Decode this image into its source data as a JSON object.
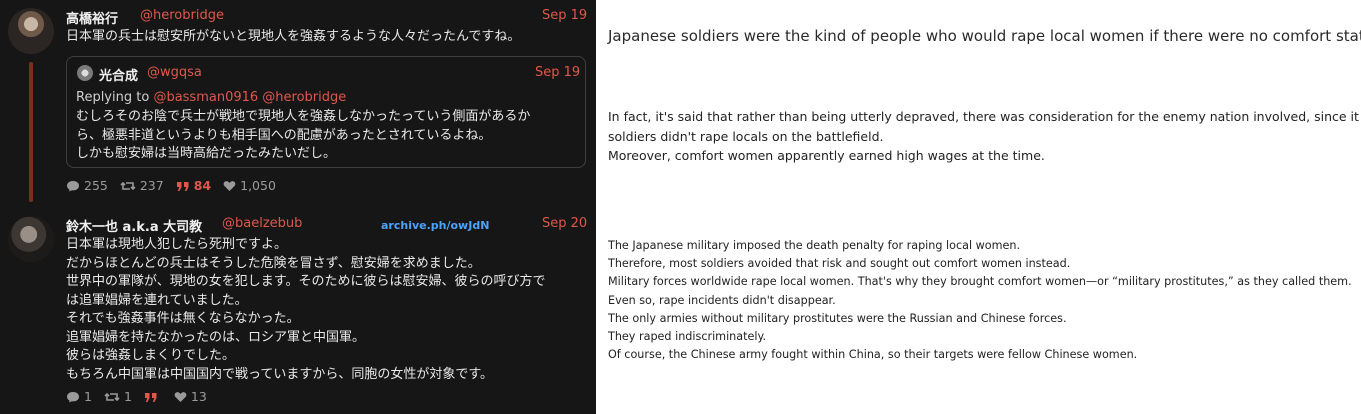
{
  "tweet1": {
    "name": "高橋裕行",
    "handle": "@herobridge",
    "date": "Sep 19",
    "text": "日本軍の兵士は慰安所がないと現地人を強姦するような人々だったんですね。",
    "quote": {
      "name": "光合成",
      "handle": "@wgqsa",
      "date": "Sep 19",
      "replying_prefix": "Replying to",
      "replying_handles": "@bassman0916 @herobridge",
      "text": "むしろそのお陰で兵士が戦地で現地人を強姦しなかったっていう側面があるか\nら、極悪非道というよりも相手国への配慮があったとされているよね。\nしかも慰安婦は当時高給だったみたいだし。"
    },
    "stats": {
      "replies": "255",
      "retweets": "237",
      "quotes": "84",
      "likes": "1,050"
    }
  },
  "tweet2": {
    "name": "鈴木一也 a.k.a 大司教",
    "handle": "@baelzebub",
    "date": "Sep 20",
    "archive_link": "archive.ph/owJdN",
    "text": "日本軍は現地人犯したら死刑ですよ。\nだからほとんどの兵士はそうした危険を冒さず、慰安婦を求めました。\n世界中の軍隊が、現地の女を犯します。そのために彼らは慰安婦、彼らの呼び方で\nは追軍娼婦を連れていました。\nそれでも強姦事件は無くならなかった。\n追軍娼婦を持たなかったのは、ロシア軍と中国軍。\n彼らは強姦しまくりでした。\nもちろん中国軍は中国国内で戦っていますから、同胞の女性が対象です。",
    "stats": {
      "replies": "1",
      "retweets": "1",
      "quotes": "",
      "likes": "13"
    }
  },
  "translations": {
    "t1": "Japanese soldiers were the kind of people who would rape local women if there were no comfort stations.",
    "t2": "In fact, it's said that rather than being utterly depraved, there was consideration for the enemy nation involved, since it meant\nsoldiers didn't rape locals on the battlefield.\nMoreover, comfort women apparently earned high wages at the time.",
    "t3": "The Japanese military imposed the death penalty for raping local women.\nTherefore, most soldiers avoided that risk and sought out comfort women instead.\nMilitary forces worldwide rape local women. That's why they brought comfort women—or “military prostitutes,” as they called them.\nEven so, rape incidents didn't disappear.\nThe only armies without military prostitutes were the Russian and Chinese forces.\nThey raped indiscriminately.\nOf course, the Chinese army fought within China, so their targets were fellow Chinese women."
  },
  "colors": {
    "panel_bg": "#161616",
    "accent": "#e0584a",
    "link": "#4aa3ff",
    "thread_line": "#7a2e22"
  }
}
